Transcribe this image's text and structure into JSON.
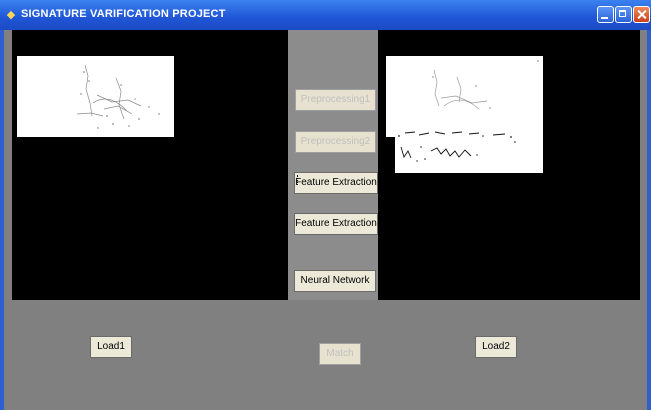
{
  "window": {
    "title": "SIGNATURE VARIFICATION PROJECT",
    "controls": [
      "minimize",
      "maximize",
      "close"
    ]
  },
  "center_buttons": [
    {
      "label": "Preprocessing1",
      "enabled": false
    },
    {
      "label": "Preprocessing2",
      "enabled": false
    },
    {
      "label": "Feature Extraction",
      "enabled": true,
      "focused": true
    },
    {
      "label": "Feature Extraction",
      "enabled": true
    },
    {
      "label": "Neural Network",
      "enabled": true
    }
  ],
  "bottom_buttons": {
    "load1": {
      "label": "Load1",
      "enabled": true
    },
    "match": {
      "label": "Match",
      "enabled": false
    },
    "load2": {
      "label": "Load2",
      "enabled": true
    }
  },
  "signature_images": {
    "left": "signature-image",
    "right_top": "signature-image",
    "right_bottom": "signature-image"
  },
  "colors": {
    "title_bar": "#1f55d6",
    "panel_bg": "#000000",
    "form_bg": "#808080",
    "button_bg": "#ece9d8"
  }
}
